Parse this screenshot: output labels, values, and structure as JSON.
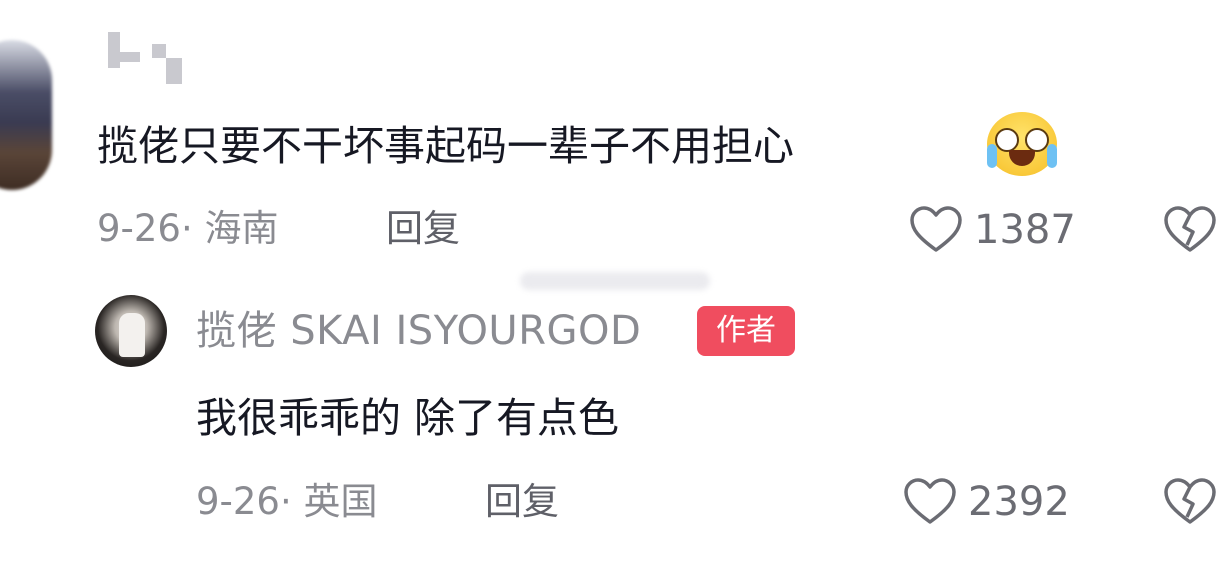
{
  "comment": {
    "text": "揽佬只要不干坏事起码一辈子不用担心",
    "emoji": "crying-laughing-emoji",
    "date_location": "9-26· 海南",
    "reply_label": "回复",
    "likes": "1387"
  },
  "reply": {
    "username": "揽佬 SKAI ISYOURGOD",
    "author_badge": "作者",
    "text": "我很乖乖的 除了有点色",
    "date_location": "9-26· 英国",
    "reply_label": "回复",
    "likes": "2392"
  },
  "colors": {
    "author_badge_bg": "#f04d5f",
    "meta_text": "#8a8b91",
    "icon_stroke": "#6b6c73"
  }
}
